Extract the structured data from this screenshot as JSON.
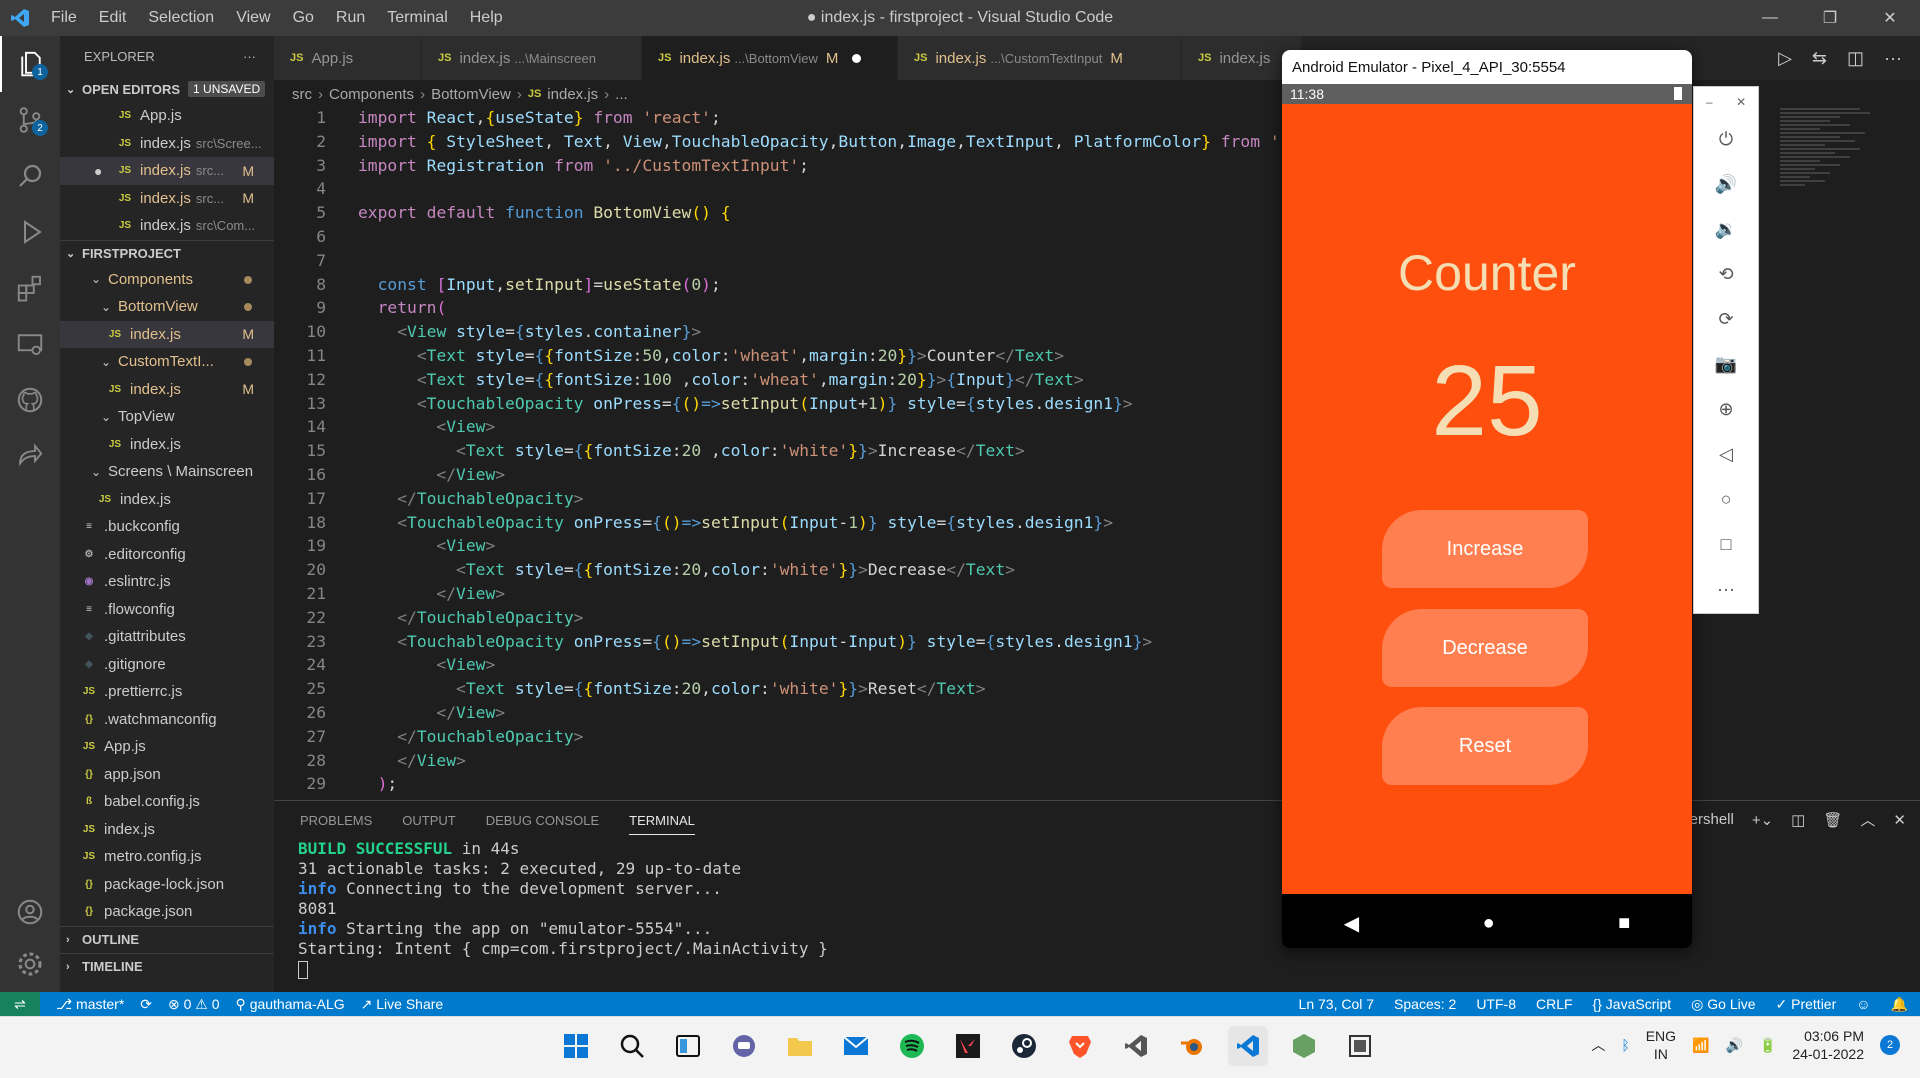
{
  "window": {
    "title": "● index.js - firstproject - Visual Studio Code",
    "menu": [
      "File",
      "Edit",
      "Selection",
      "View",
      "Go",
      "Run",
      "Terminal",
      "Help"
    ]
  },
  "sidebar": {
    "header": "EXPLORER",
    "open_editors": "OPEN EDITORS",
    "unsaved": "1 UNSAVED",
    "open_items": [
      {
        "name": "App.js",
        "sub": ""
      },
      {
        "name": "index.js",
        "sub": "src\\Scree..."
      },
      {
        "name": "index.js",
        "sub": "src...",
        "mod": "M"
      },
      {
        "name": "index.js",
        "sub": "src...",
        "mod": "M"
      },
      {
        "name": "index.js",
        "sub": "src\\Com..."
      }
    ],
    "project": "FIRSTPROJECT",
    "tree": [
      {
        "name": "Components"
      },
      {
        "name": "BottomView"
      },
      {
        "name": "index.js",
        "mod": "M"
      },
      {
        "name": "CustomTextI..."
      },
      {
        "name": "index.js",
        "mod": "M"
      },
      {
        "name": "TopView"
      },
      {
        "name": "index.js"
      },
      {
        "name": "Screens \\ Mainscreen"
      },
      {
        "name": "index.js"
      },
      {
        "name": ".buckconfig"
      },
      {
        "name": ".editorconfig"
      },
      {
        "name": ".eslintrc.js"
      },
      {
        "name": ".flowconfig"
      },
      {
        "name": ".gitattributes"
      },
      {
        "name": ".gitignore"
      },
      {
        "name": ".prettierrc.js"
      },
      {
        "name": ".watchmanconfig"
      },
      {
        "name": "App.js"
      },
      {
        "name": "app.json"
      },
      {
        "name": "babel.config.js"
      },
      {
        "name": "index.js"
      },
      {
        "name": "metro.config.js"
      },
      {
        "name": "package-lock.json"
      },
      {
        "name": "package.json"
      }
    ],
    "outline": "OUTLINE",
    "timeline": "TIMELINE"
  },
  "tabs": [
    {
      "name": "App.js",
      "desc": ""
    },
    {
      "name": "index.js",
      "desc": "...\\Mainscreen"
    },
    {
      "name": "index.js",
      "desc": "...\\BottomView",
      "mod": "M"
    },
    {
      "name": "index.js",
      "desc": "...\\CustomTextInput",
      "mod": "M"
    },
    {
      "name": "index.js",
      "desc": ""
    }
  ],
  "breadcrumb": [
    "src",
    "Components",
    "BottomView",
    "index.js",
    "..."
  ],
  "code_lines": [
    "1",
    "2",
    "3",
    "4",
    "5",
    "6",
    "7",
    "8",
    "9",
    "10",
    "11",
    "12",
    "13",
    "14",
    "15",
    "16",
    "17",
    "18",
    "19",
    "20",
    "21",
    "22",
    "23",
    "24",
    "25",
    "26",
    "27",
    "28",
    "29"
  ],
  "panel": {
    "tabs": [
      "PROBLEMS",
      "OUTPUT",
      "DEBUG CONSOLE",
      "TERMINAL"
    ],
    "shell": "ershell",
    "build_ok": "BUILD SUCCESSFUL",
    "build_time": " in 44s",
    "line2": "31 actionable tasks: 2 executed, 29 up-to-date",
    "info": "info",
    "line3": " Connecting to the development server...",
    "line4": "8081",
    "line5": " Starting the app on \"emulator-5554\"...",
    "line6": "Starting: Intent { cmp=com.firstproject/.MainActivity }"
  },
  "statusbar": {
    "branch": "master*",
    "errors": "⊗ 0 ⚠ 0",
    "user": "gauthama-ALG",
    "liveshare": "Live Share",
    "position": "Ln 73, Col 7",
    "spaces": "Spaces: 2",
    "encoding": "UTF-8",
    "eol": "CRLF",
    "language": "{} JavaScript",
    "golive": "Go Live",
    "prettier": "✓ Prettier"
  },
  "emulator": {
    "title": "Android Emulator - Pixel_4_API_30:5554",
    "time": "11:38",
    "counter_label": "Counter",
    "counter_value": "25",
    "buttons": [
      "Increase",
      "Decrease",
      "Reset"
    ]
  },
  "taskbar": {
    "lang1": "ENG",
    "lang2": "IN",
    "time": "03:06 PM",
    "date": "24-01-2022",
    "notif": "2"
  },
  "colors": {
    "accent": "#007acc",
    "emulator_bg": "#ff4f0f",
    "button": "#ff7f50",
    "wheat": "#f5deb3"
  }
}
